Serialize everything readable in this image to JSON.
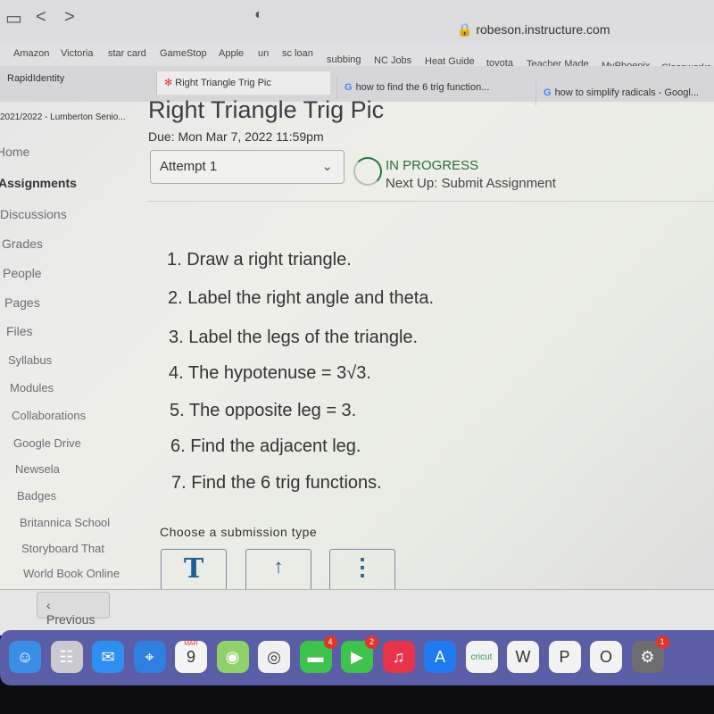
{
  "browser": {
    "url": "robeson.instructure.com",
    "back": "<",
    "forward": ">"
  },
  "bookmarks": [
    "Amazon",
    "Victoria",
    "star card",
    "GameStop",
    "Apple",
    "un",
    "sc loan",
    "subbing",
    "NC Jobs",
    "Heat Guide",
    "toyota",
    "Teacher Made",
    "MyPhoenix",
    "Classworks"
  ],
  "tabs": [
    {
      "label": "RapidIdentity"
    },
    {
      "label": "Right Triangle Trig Pic",
      "active": true
    },
    {
      "label": "how to find the 6 trig function..."
    },
    {
      "label": "how to simplify radicals - Googl..."
    }
  ],
  "course": "2021/2022 - Lumberton Senio...",
  "sidebar": [
    "Home",
    "Assignments",
    "Discussions",
    "Grades",
    "People",
    "Pages",
    "Files",
    "Syllabus",
    "Modules",
    "Collaborations",
    "Google Drive",
    "Newsela",
    "Badges",
    "Britannica School",
    "Storyboard That",
    "World Book Online"
  ],
  "sidebar_active": "Assignments",
  "assignment": {
    "title": "Right Triangle Trig Pic",
    "due": "Due: Mon Mar 7, 2022 11:59pm",
    "attempt": "Attempt 1",
    "status": "IN PROGRESS",
    "next": "Next Up: Submit Assignment"
  },
  "steps": [
    "1. Draw a right triangle.",
    "2. Label the right angle and theta.",
    "3. Label the legs of the triangle.",
    "4. The hypotenuse = 3√3.",
    "5. The opposite leg = 3.",
    "6. Find the adjacent leg.",
    "7. Find the 6 trig functions."
  ],
  "submission": {
    "label": "Choose a submission type",
    "types": [
      {
        "icon": "text-entry-icon",
        "glyph": "T"
      },
      {
        "icon": "upload-icon",
        "glyph": "↑"
      },
      {
        "icon": "more-icon",
        "glyph": "⋮"
      }
    ]
  },
  "footer": {
    "previous": "Previous"
  },
  "dock": [
    {
      "name": "finder",
      "glyph": "☺",
      "color": "#3a8ee6"
    },
    {
      "name": "launchpad",
      "glyph": "☷",
      "color": "#c9c9cf"
    },
    {
      "name": "mail",
      "glyph": "✉",
      "color": "#2f8ff0"
    },
    {
      "name": "safari",
      "glyph": "⌖",
      "color": "#2f7fe0"
    },
    {
      "name": "calendar",
      "glyph": "9",
      "color": "#f4f4f4",
      "month": "MAR"
    },
    {
      "name": "maps",
      "glyph": "◉",
      "color": "#8fd16a"
    },
    {
      "name": "chrome",
      "glyph": "◎",
      "color": "#f0f0f0"
    },
    {
      "name": "messages",
      "glyph": "▬",
      "color": "#3dc24b",
      "badge": "4"
    },
    {
      "name": "facetime",
      "glyph": "▶",
      "color": "#3dc24b",
      "badge": "2"
    },
    {
      "name": "music",
      "glyph": "♫",
      "color": "#e8344a"
    },
    {
      "name": "app-store",
      "glyph": "A",
      "color": "#1f7cf0"
    },
    {
      "name": "cricut",
      "glyph": "cricut",
      "color": "#f2f2f2"
    },
    {
      "name": "word",
      "glyph": "W",
      "color": "#f2f2f2"
    },
    {
      "name": "powerpoint",
      "glyph": "P",
      "color": "#f2f2f2"
    },
    {
      "name": "outlook",
      "glyph": "O",
      "color": "#f2f2f2"
    },
    {
      "name": "system-preferences",
      "glyph": "⚙",
      "color": "#6d6d72",
      "badge": "1"
    }
  ]
}
